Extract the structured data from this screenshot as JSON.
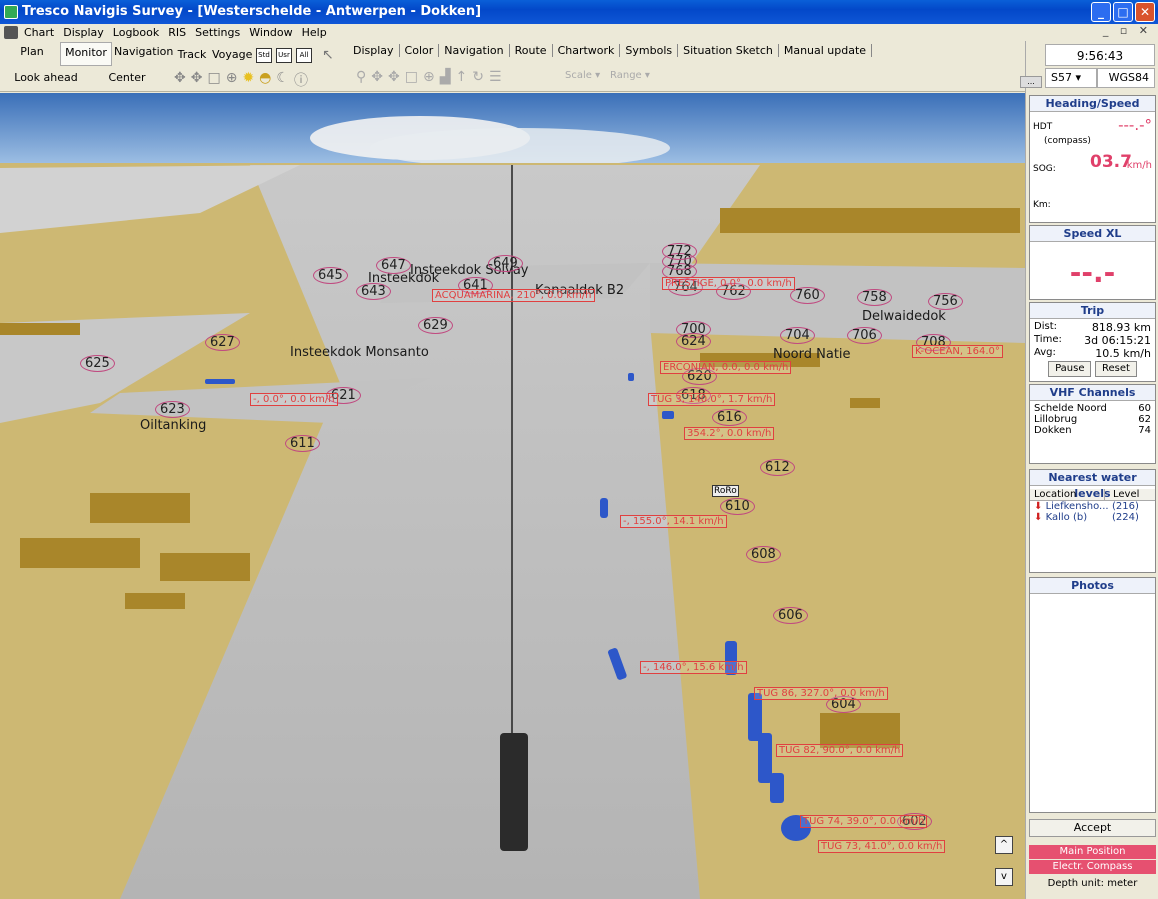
{
  "window": {
    "title": "Tresco Navigis Survey - [Westerschelde - Antwerpen - Dokken]"
  },
  "menu": [
    "Chart",
    "Display",
    "Logbook",
    "RIS",
    "Settings",
    "Window",
    "Help"
  ],
  "toolbar": {
    "plan": "Plan",
    "monitor": "Monitor",
    "navigation": "Navigation",
    "track": "Track",
    "voyage": "Voyage",
    "std": "Std",
    "usr": "Usr",
    "all": "All",
    "look_ahead": "Look ahead",
    "center_ship": "Center ship",
    "tabs": [
      "Display",
      "Color",
      "Navigation",
      "Route",
      "Chartwork",
      "Symbols",
      "Situation Sketch",
      "Manual update"
    ],
    "scale": "Scale",
    "range": "Range"
  },
  "header": {
    "time": "9:56:43",
    "s57": "S57",
    "datum": "WGS84"
  },
  "heading_speed": {
    "title": "Heading/Speed",
    "hdt_label": "HDT",
    "hdt_sub": "(compass)",
    "hdt_value": "---.-°",
    "sog_label": "SOG:",
    "sog_value": "03.7",
    "sog_unit": "km/h",
    "km_label": "Km:"
  },
  "speed_xl": {
    "title": "Speed XL",
    "value": "--.-"
  },
  "trip": {
    "title": "Trip",
    "dist_label": "Dist:",
    "dist": "818.93 km",
    "time_label": "Time:",
    "time": "3d 06:15:21",
    "avg_label": "Avg:",
    "avg": "10.5 km/h",
    "pause": "Pause",
    "reset": "Reset"
  },
  "vhf": {
    "title": "VHF Channels",
    "channels": [
      {
        "name": "Schelde Noord",
        "ch": "60"
      },
      {
        "name": "Lillobrug",
        "ch": "62"
      },
      {
        "name": "Dokken",
        "ch": "74"
      }
    ]
  },
  "water": {
    "title": "Nearest water levels",
    "col_location": "Location",
    "col_level": "Level",
    "rows": [
      {
        "name": "Liefkensho...",
        "level": "(216)"
      },
      {
        "name": "Kallo (b)",
        "level": "(224)"
      }
    ]
  },
  "photos": {
    "title": "Photos"
  },
  "bottom": {
    "accept": "Accept",
    "main_position": "Main Position",
    "compass": "Electr. Compass",
    "depth": "Depth unit: meter"
  },
  "map": {
    "labels": [
      "Insteekdok Solvay",
      "Kanaaldok B2",
      "Insteekdok Monsanto",
      "Oiltanking",
      "Delwaidedok",
      "Noord Natie",
      "Insteekdok"
    ],
    "km": [
      "625",
      "627",
      "623",
      "621",
      "611",
      "629",
      "645",
      "643",
      "641",
      "647",
      "649",
      "700",
      "624",
      "620",
      "618",
      "616",
      "612",
      "610",
      "608",
      "606",
      "604",
      "602",
      "704",
      "706",
      "708",
      "756",
      "758",
      "760",
      "762",
      "764",
      "768",
      "770",
      "772"
    ],
    "vessels": [
      "ACQUAMARINA, 210°, 0.0 km/h",
      "PRESTIGE, 0.0°, 0.0 km/h",
      "K-OCEAN, 164.0°",
      "ERCONIAN, 0.0, 0.0 km/h",
      "TUG 3, 140.0°, 1.7 km/h",
      "354.2°, 0.0 km/h",
      "-, 0.0°, 0.0 km/h",
      "-, 155.0°, 14.1 km/h",
      "-, 146.0°, 15.6 km/h",
      "TUG 86, 327.0°, 0.0 km/h",
      "TUG 82, 90.0°, 0.0 km/h",
      "TUG 74, 39.0°, 0.0 km/h",
      "TUG 73, 41.0°, 0.0 km/h"
    ],
    "roro": "RoRo"
  }
}
